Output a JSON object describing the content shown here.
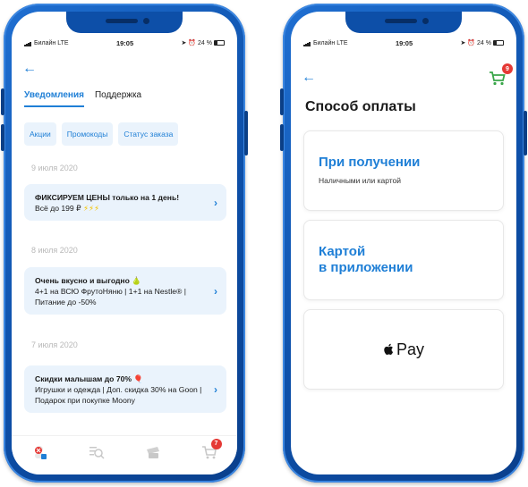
{
  "status_bar": {
    "carrier": "Билайн",
    "network": "LTE",
    "time": "19:05",
    "battery": "24 %"
  },
  "left": {
    "tabs": [
      {
        "label": "Уведомления",
        "active": true
      },
      {
        "label": "Поддержка",
        "active": false
      }
    ],
    "chips": [
      "Акции",
      "Промокоды",
      "Статус заказа"
    ],
    "groups": [
      {
        "date": "9 июля 2020",
        "title": "ФИКСИРУЕМ ЦЕНЫ",
        "title_rest": " только на 1 день!",
        "body": "Всё до 199 ₽",
        "emoji": "⚡⚡⚡"
      },
      {
        "date": "8 июля 2020",
        "title": "Очень вкусно и выгодно",
        "emoji": "🍐",
        "body": "4+1 на ВСЮ ФрутоНяню | 1+1 на Nestle® | Питание до -50%"
      },
      {
        "date": "7 июля 2020",
        "title": "Скидки малышам до 70%",
        "emoji": "🎈",
        "body": "Игрушки и одежда | Доп. скидка 30% на Goon | Подарок при покупке Moony"
      }
    ],
    "tabbar": {
      "cart_badge": "7",
      "icons": [
        "profile-icon",
        "catalog-search-icon",
        "gift-icon",
        "cart-icon"
      ]
    }
  },
  "right": {
    "cart_badge": "9",
    "title": "Способ оплаты",
    "options": [
      {
        "title": "При получении",
        "subtitle": "Наличными или картой"
      },
      {
        "title_line1": "Картой",
        "title_line2": "в приложении"
      },
      {
        "brand": "Pay"
      }
    ]
  },
  "colors": {
    "accent": "#1f7fd6",
    "card_bg": "#eaf3fc",
    "phone_frame": "#0d4fa8",
    "badge": "#e53935",
    "date_text": "#b8b8b8"
  }
}
